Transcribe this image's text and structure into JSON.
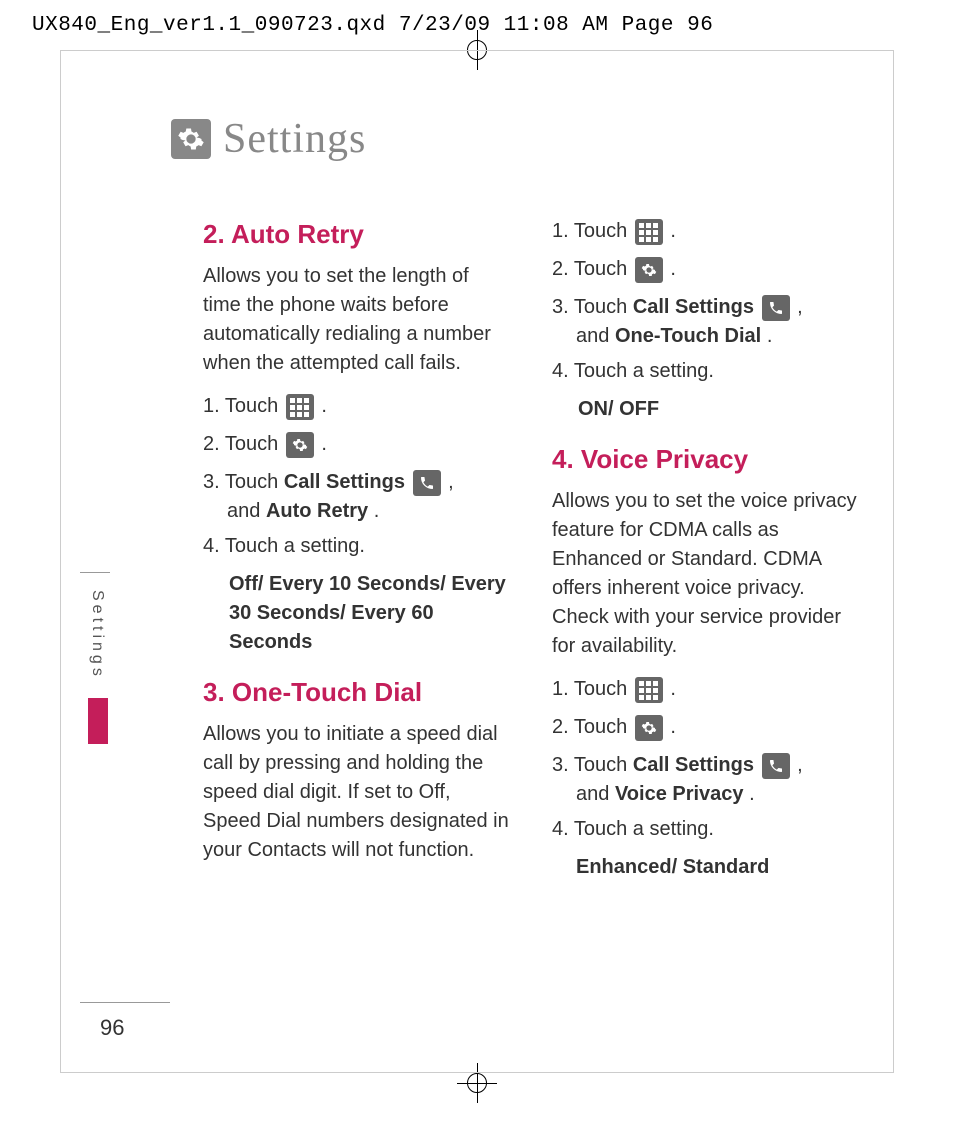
{
  "print_header": "UX840_Eng_ver1.1_090723.qxd  7/23/09  11:08 AM  Page 96",
  "page_title": "Settings",
  "side_tab": "Settings",
  "page_number": "96",
  "left": {
    "s2": {
      "heading": "2. Auto Retry",
      "desc": "Allows you to set the length of time the phone waits before automatically redialing a number when the attempted call fails.",
      "step1_a": "1. Touch ",
      "step1_b": ".",
      "step2_a": "2. Touch ",
      "step2_b": ".",
      "step3_a": "3. Touch ",
      "step3_bold1": "Call Settings",
      "step3_b": " ,",
      "step3_c": "and ",
      "step3_bold2": "Auto Retry",
      "step3_d": ".",
      "step4": "4. Touch a setting.",
      "options": "Off/ Every 10 Seconds/ Every 30 Seconds/ Every 60 Seconds"
    },
    "s3": {
      "heading": "3. One-Touch Dial",
      "desc": "Allows you to initiate a speed dial call by pressing and holding the speed dial digit. If set to Off, Speed Dial numbers designated in your Contacts will not function."
    }
  },
  "right": {
    "otd": {
      "step1_a": "1. Touch ",
      "step1_b": ".",
      "step2_a": "2. Touch ",
      "step2_b": ".",
      "step3_a": "3. Touch ",
      "step3_bold1": "Call Settings",
      "step3_b": " ,",
      "step3_c": "and ",
      "step3_bold2": "One-Touch Dial",
      "step3_d": ".",
      "step4": "4. Touch a setting.",
      "options": "ON/ OFF"
    },
    "s4": {
      "heading": "4. Voice Privacy",
      "desc": "Allows you to set the voice privacy feature for CDMA calls as Enhanced or Standard. CDMA offers inherent voice privacy. Check with your service provider for availability.",
      "step1_a": "1. Touch ",
      "step1_b": ".",
      "step2_a": "2. Touch ",
      "step2_b": ".",
      "step3_a": "3. Touch ",
      "step3_bold1": "Call Settings",
      "step3_b": " ,",
      "step3_c": "and ",
      "step3_bold2": "Voice Privacy",
      "step3_d": ".",
      "step4": "4. Touch a setting.",
      "options": "Enhanced/ Standard"
    }
  }
}
